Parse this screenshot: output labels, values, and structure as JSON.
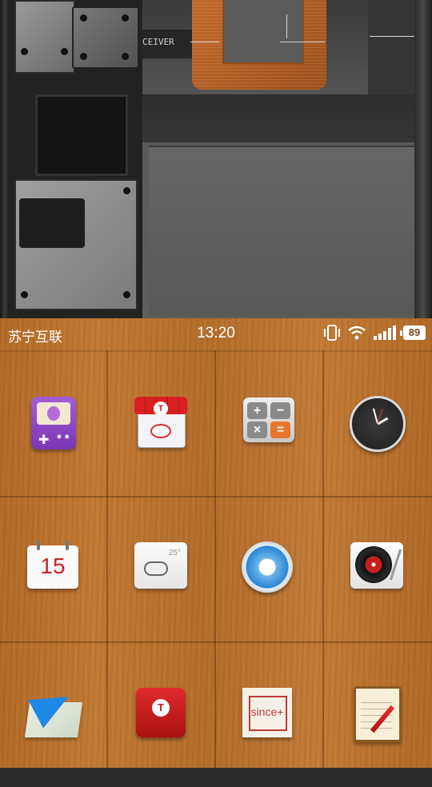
{
  "status_bar": {
    "carrier": "苏宁互联",
    "time": "13:20",
    "battery": "89",
    "icons": [
      "vibrate-icon",
      "wifi-icon",
      "signal-icon",
      "battery-icon"
    ]
  },
  "wallpaper": {
    "receiver_text": "CEIVER"
  },
  "apps": [
    {
      "row": 0,
      "col": 0,
      "icon": "game-console-icon"
    },
    {
      "row": 0,
      "col": 1,
      "icon": "store-icon"
    },
    {
      "row": 0,
      "col": 2,
      "icon": "calculator-icon",
      "keys": [
        "+",
        "−",
        "×",
        "="
      ]
    },
    {
      "row": 0,
      "col": 3,
      "icon": "clock-icon"
    },
    {
      "row": 1,
      "col": 0,
      "icon": "calendar-icon",
      "day": "15"
    },
    {
      "row": 1,
      "col": 1,
      "icon": "weather-icon",
      "temperature": "25°"
    },
    {
      "row": 1,
      "col": 2,
      "icon": "blue-ring-icon"
    },
    {
      "row": 1,
      "col": 3,
      "icon": "record-player-icon"
    },
    {
      "row": 2,
      "col": 0,
      "icon": "map-plane-icon"
    },
    {
      "row": 2,
      "col": 1,
      "icon": "red-app-icon"
    },
    {
      "row": 2,
      "col": 2,
      "icon": "since-icon",
      "text": "since+"
    },
    {
      "row": 2,
      "col": 3,
      "icon": "notepad-icon"
    }
  ],
  "colors": {
    "wood": "#bb7431",
    "accent_red": "#d92020",
    "accent_orange": "#e8752a",
    "accent_blue": "#2a86d6"
  }
}
